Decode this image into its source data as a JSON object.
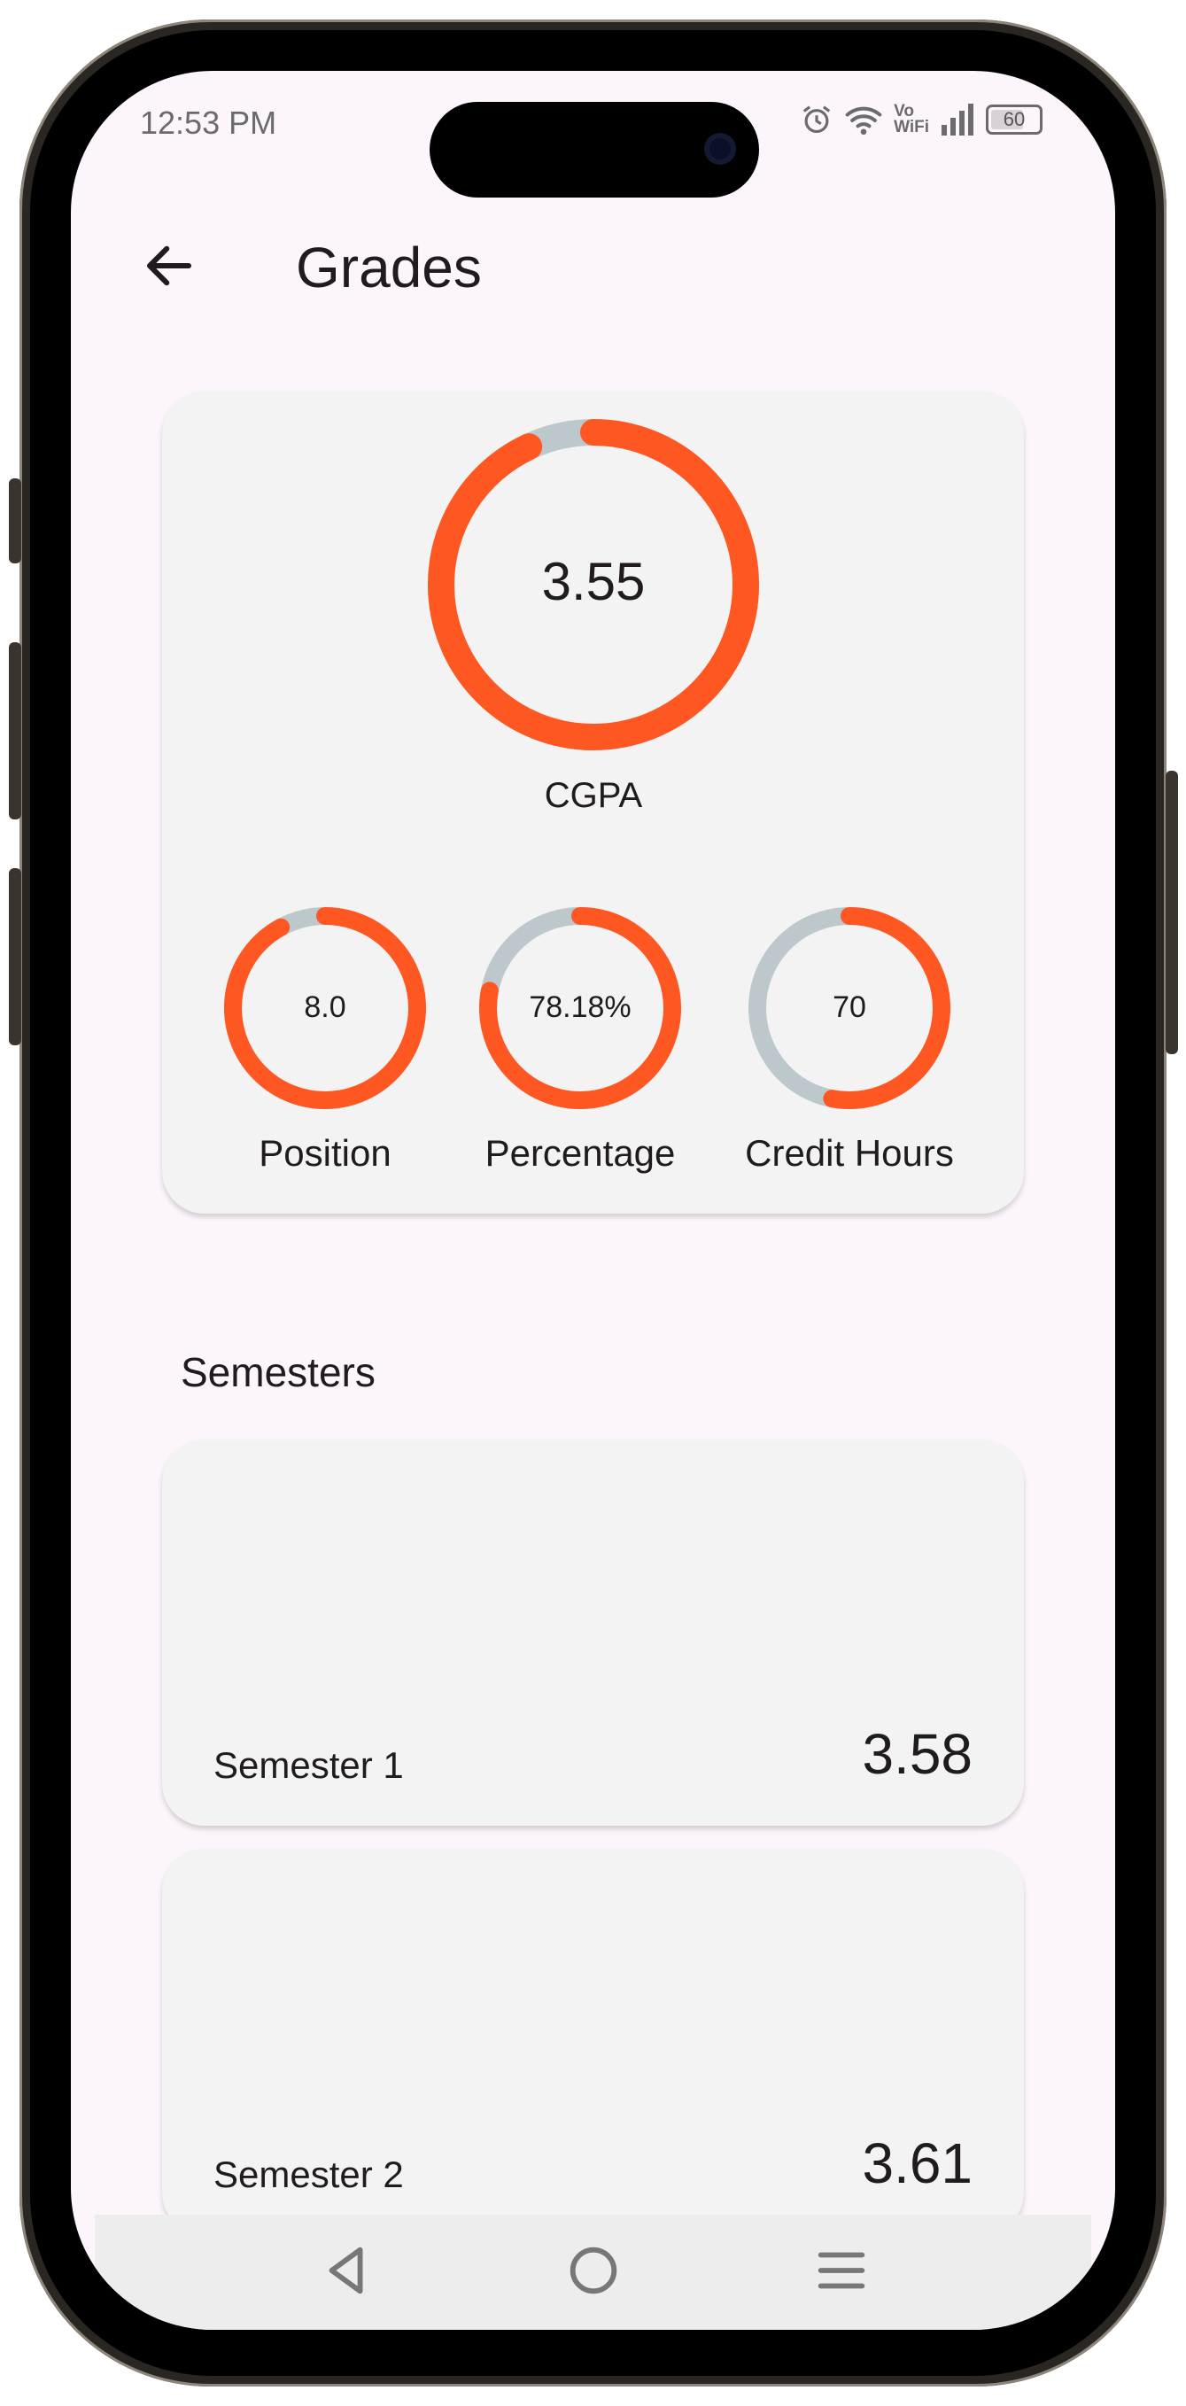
{
  "status_bar": {
    "time": "12:53 PM",
    "vo_wifi": "Vo\nWiFi",
    "battery": "60"
  },
  "header": {
    "title": "Grades"
  },
  "summary": {
    "cgpa": {
      "value": "3.55",
      "label": "CGPA",
      "fraction": 0.93
    },
    "position": {
      "value": "8.0",
      "label": "Position",
      "fraction": 0.92
    },
    "percentage": {
      "value": "78.18%",
      "label": "Percentage",
      "fraction": 0.78
    },
    "credit_hours": {
      "value": "70",
      "label": "Credit Hours",
      "fraction": 0.53
    }
  },
  "semesters": {
    "heading": "Semesters",
    "items": [
      {
        "label": "Semester 1",
        "gpa": "3.58"
      },
      {
        "label": "Semester 2",
        "gpa": "3.61"
      }
    ]
  },
  "colors": {
    "accent": "#FF5722",
    "track": "#BCC8CC",
    "card": "#F3F3F3",
    "background": "#FCF5FB"
  },
  "icons": [
    "back-arrow-icon",
    "alarm-icon",
    "wifi-icon",
    "signal-icon",
    "battery-icon",
    "nav-back-icon",
    "nav-home-icon",
    "nav-menu-icon"
  ]
}
